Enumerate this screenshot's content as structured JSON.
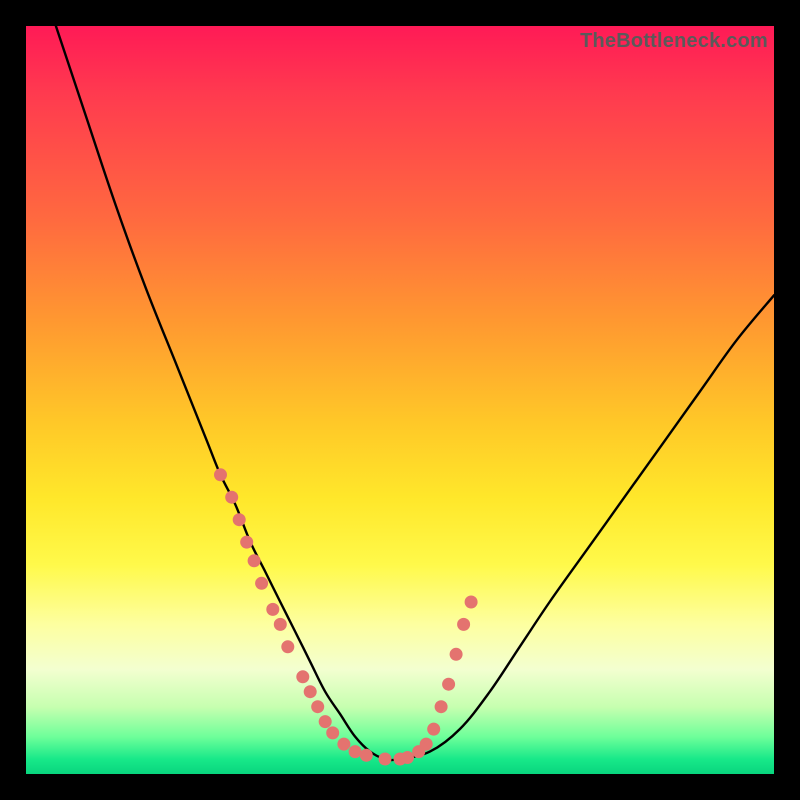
{
  "watermark": "TheBottleneck.com",
  "colors": {
    "frame": "#000000",
    "curve": "#000000",
    "dots": "#e4736f",
    "gradient_top": "#ff1a56",
    "gradient_bottom": "#08d57e"
  },
  "chart_data": {
    "type": "line",
    "title": "",
    "xlabel": "",
    "ylabel": "",
    "xlim": [
      0,
      100
    ],
    "ylim": [
      0,
      100
    ],
    "grid": false,
    "series": [
      {
        "name": "bottleneck-curve",
        "x": [
          4,
          8,
          12,
          16,
          20,
          24,
          26,
          28,
          30,
          32,
          34,
          36,
          38,
          40,
          42,
          44,
          46,
          48,
          50,
          54,
          58,
          62,
          66,
          70,
          75,
          80,
          85,
          90,
          95,
          100
        ],
        "y": [
          100,
          88,
          76,
          65,
          55,
          45,
          40,
          36,
          31,
          27,
          23,
          19,
          15,
          11,
          8,
          5,
          3,
          2,
          2,
          3,
          6,
          11,
          17,
          23,
          30,
          37,
          44,
          51,
          58,
          64
        ]
      }
    ],
    "scatter_points": {
      "name": "highlighted-points",
      "x": [
        26,
        27.5,
        28.5,
        29.5,
        30.5,
        31.5,
        33,
        34,
        35,
        37,
        38,
        39,
        40,
        41,
        42.5,
        44,
        45.5,
        48,
        50,
        51,
        52.5,
        53.5,
        54.5,
        55.5,
        56.5,
        57.5,
        58.5,
        59.5
      ],
      "y": [
        40,
        37,
        34,
        31,
        28.5,
        25.5,
        22,
        20,
        17,
        13,
        11,
        9,
        7,
        5.5,
        4,
        3,
        2.5,
        2,
        2,
        2.2,
        3,
        4,
        6,
        9,
        12,
        16,
        20,
        23
      ]
    }
  }
}
